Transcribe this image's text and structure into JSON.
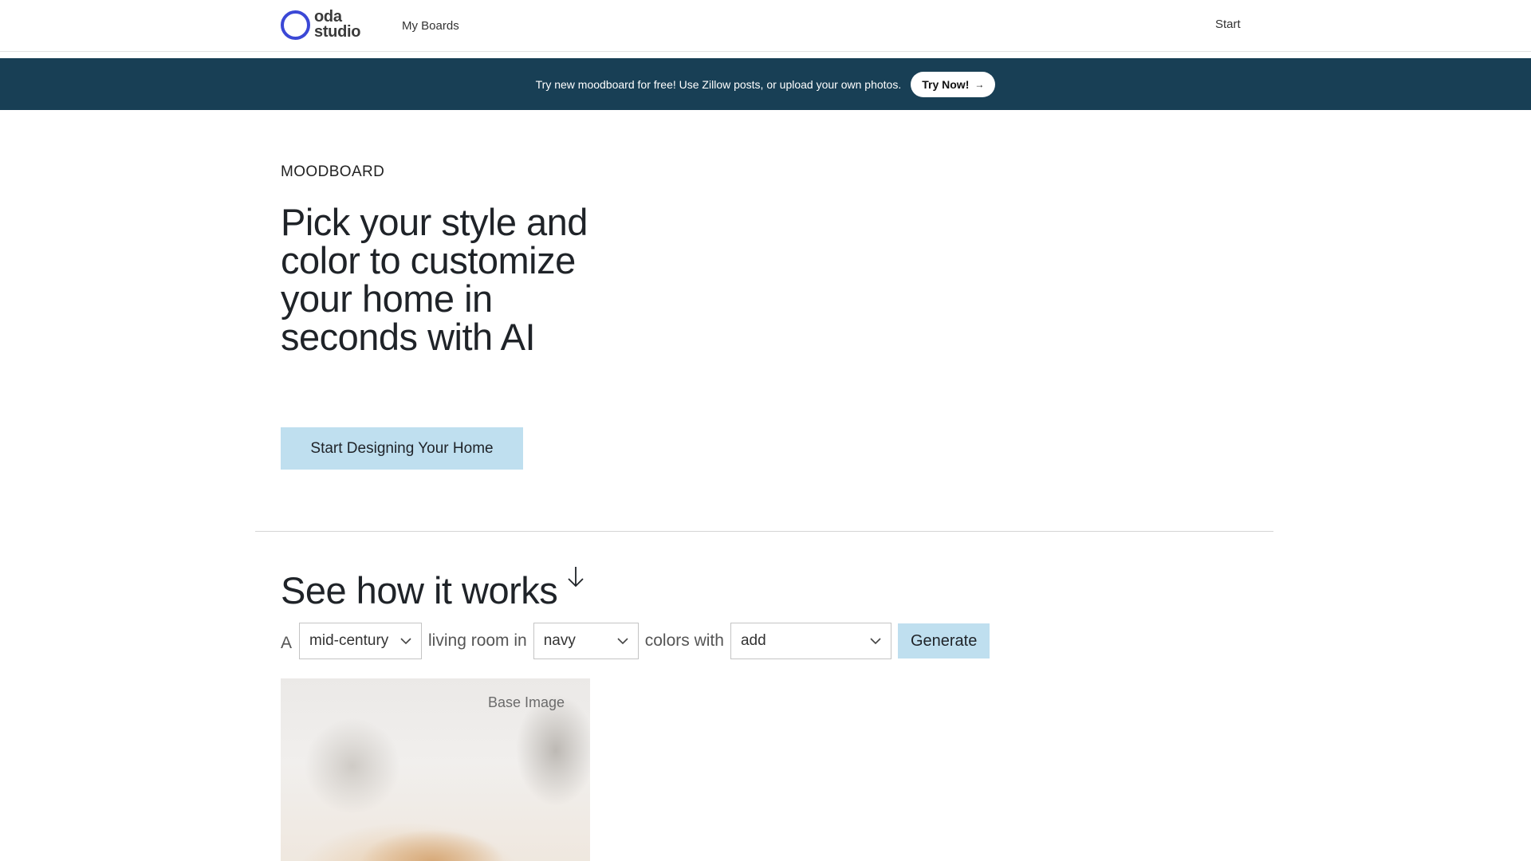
{
  "header": {
    "logo_line1": "oda",
    "logo_line2": "studio",
    "nav_boards": "My Boards",
    "nav_start": "Start"
  },
  "banner": {
    "text": "Try new moodboard for free! Use Zillow posts, or upload your own photos.",
    "button_label": "Try Now!",
    "button_arrow": "→"
  },
  "hero": {
    "eyebrow": "MOODBOARD",
    "headline": "Pick your style and color to customize your home in seconds with AI",
    "cta_label": "Start Designing Your Home"
  },
  "how_it_works": {
    "title": "See how it works",
    "word_a": "A",
    "style_value": "mid-century",
    "word_room": "living room in",
    "color_value": "navy",
    "word_colors": "colors with",
    "add_value": "add",
    "generate_label": "Generate",
    "preview_label": "Base Image"
  },
  "colors": {
    "brand_ring": "#3b48d6",
    "banner_bg": "#183f55",
    "button_light_blue": "#bfdfef"
  },
  "icons": {
    "logo": "ring-logo-icon",
    "banner_arrow": "arrow-right-icon",
    "section_arrow": "arrow-down-icon",
    "select_chevron": "chevron-down-icon"
  }
}
